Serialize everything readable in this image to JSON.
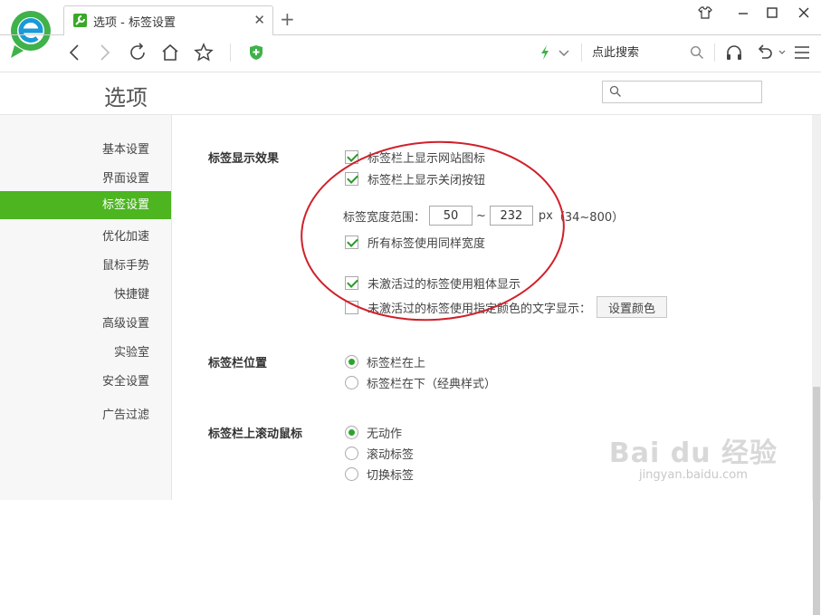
{
  "browser": {
    "tab_title": "选项 - 标签设置",
    "address_search_label": "点此搜索"
  },
  "options": {
    "title": "选项",
    "search_placeholder": ""
  },
  "sidebar": {
    "items": [
      {
        "label": "基本设置"
      },
      {
        "label": "界面设置"
      },
      {
        "label": "标签设置",
        "active": true
      },
      {
        "label": "优化加速"
      },
      {
        "label": "鼠标手势"
      },
      {
        "label": "快捷键"
      },
      {
        "label": "高级设置"
      },
      {
        "label": "实验室"
      },
      {
        "label": "安全设置"
      },
      {
        "label": "广告过滤"
      }
    ]
  },
  "tab_display": {
    "section_label": "标签显示效果",
    "show_site_icon": "标签栏上显示网站图标",
    "show_close_button": "标签栏上显示关闭按钮",
    "width_range_label": "标签宽度范围：",
    "width_min": "50",
    "tilde": "~",
    "width_max": "232",
    "width_unit": "px",
    "width_hint": "（34~800）",
    "same_width": "所有标签使用同样宽度",
    "bold_inactive": "未激活过的标签使用粗体显示",
    "color_inactive": "未激活过的标签使用指定颜色的文字显示：",
    "set_color_button": "设置颜色"
  },
  "tab_position": {
    "section_label": "标签栏位置",
    "top": "标签栏在上",
    "bottom": "标签栏在下（经典样式）"
  },
  "tab_scroll": {
    "section_label": "标签栏上滚动鼠标",
    "none": "无动作",
    "scroll": "滚动标签",
    "switch": "切换标签"
  },
  "watermark": {
    "main": "Bai du 经验",
    "sub": "jingyan.baidu.com"
  },
  "colors": {
    "accent": "#4cb520",
    "annotation": "#d0202a"
  }
}
